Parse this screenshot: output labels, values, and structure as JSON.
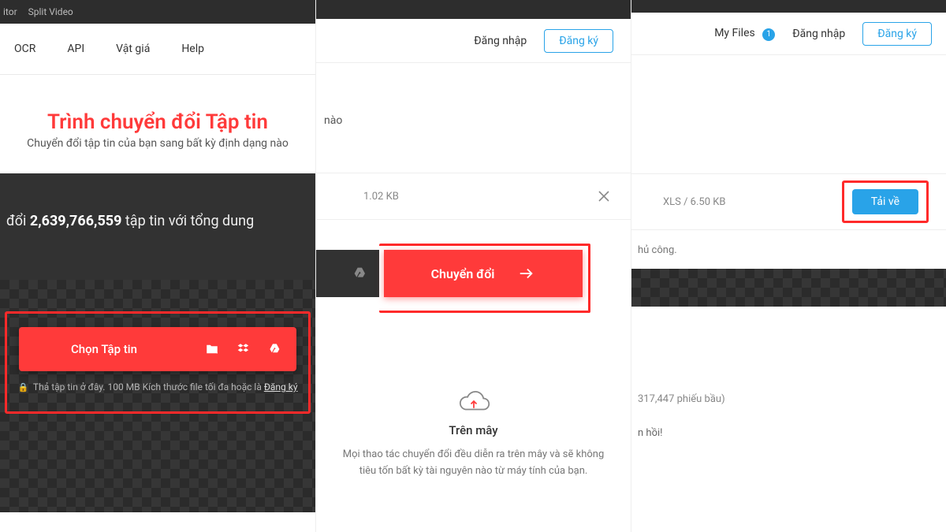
{
  "col1": {
    "topbar": {
      "link1": "itor",
      "link2": "Split Video"
    },
    "menu": {
      "item1": "OCR",
      "item2": "API",
      "item3": "Vật giá",
      "item4": "Help"
    },
    "hero": {
      "title": "Trình chuyển đổi Tập tin",
      "subtitle": "Chuyển đổi tập tin của bạn sang bất kỳ định dạng nào"
    },
    "stats": {
      "prefix": "đổi ",
      "number": "2,639,766,559",
      "suffix": " tập tin với tổng dung"
    },
    "choose_label": "Chọn Tập tin",
    "drop_hint_text": "Thả tập tin ở đây. 100 MB Kích thước file tối đa hoặc là ",
    "drop_hint_link": "Đăng ký"
  },
  "col2": {
    "auth": {
      "login": "Đăng nhập",
      "register": "Đăng ký"
    },
    "fragment": "nào",
    "file_size": "1.02 KB",
    "convert_label": "Chuyển đổi",
    "cloud": {
      "title": "Trên mây",
      "desc": "Mọi thao tác chuyển đổi đều diễn ra trên mây và sẽ không tiêu tốn bất kỳ tài nguyên nào từ máy tính của bạn."
    }
  },
  "col3": {
    "header": {
      "myfiles": "My Files",
      "badge": "1",
      "login": "Đăng nhập",
      "register": "Đăng ký"
    },
    "result": {
      "meta": "XLS / 6.50 KB",
      "download": "Tải về"
    },
    "frag1": "hủ công.",
    "votes": "317,447 phiếu bầu)",
    "cta": "n hồi!"
  }
}
